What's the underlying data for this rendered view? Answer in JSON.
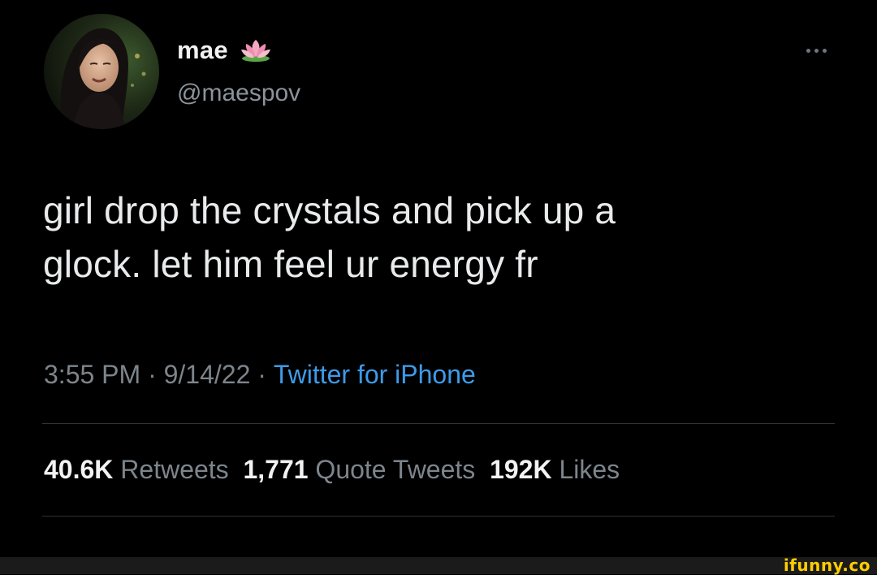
{
  "user": {
    "display_name": "mae",
    "name_emoji": "lotus-icon",
    "handle": "@maespov",
    "avatar": "profile-photo"
  },
  "tweet": {
    "text_line1": "girl drop the crystals and pick up a",
    "text_line2": "glock. let him feel ur energy fr",
    "time": "3:55 PM",
    "separator": " · ",
    "date": "9/14/22",
    "source": "Twitter for iPhone"
  },
  "stats": {
    "retweets_count": "40.6K",
    "retweets_label": "Retweets",
    "quotes_count": "1,771",
    "quotes_label": "Quote Tweets",
    "likes_count": "192K",
    "likes_label": "Likes"
  },
  "watermark": {
    "text": "ifunny.co"
  },
  "colors": {
    "background": "#000000",
    "text": "#e9eaeb",
    "muted": "#7d858c",
    "link": "#3d9be9",
    "divider": "#2f3336",
    "watermark": "#ffcc00"
  }
}
